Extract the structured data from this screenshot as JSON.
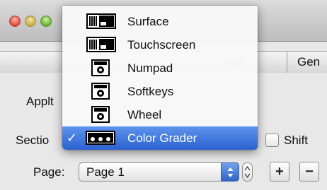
{
  "tabs": [
    {
      "label": "ons"
    },
    {
      "label": "Gen"
    }
  ],
  "subtab": {
    "label": "Applt"
  },
  "section": {
    "label": "Sectio"
  },
  "shift": {
    "label": "Shift",
    "checked": false
  },
  "page": {
    "label": "Page:",
    "value": "Page 1"
  },
  "buttons": {
    "add": "+",
    "remove": "−"
  },
  "menu": {
    "items": [
      {
        "label": "Surface",
        "icon": "surface-icon",
        "selected": false
      },
      {
        "label": "Touchscreen",
        "icon": "touchscreen-icon",
        "selected": false
      },
      {
        "label": "Numpad",
        "icon": "numpad-icon",
        "selected": false
      },
      {
        "label": "Softkeys",
        "icon": "softkeys-icon",
        "selected": false
      },
      {
        "label": "Wheel",
        "icon": "wheel-icon",
        "selected": false
      },
      {
        "label": "Color Grader",
        "icon": "color-grader-icon",
        "selected": true,
        "check": "✓"
      }
    ]
  },
  "colors": {
    "accent": "#2b62d1"
  }
}
